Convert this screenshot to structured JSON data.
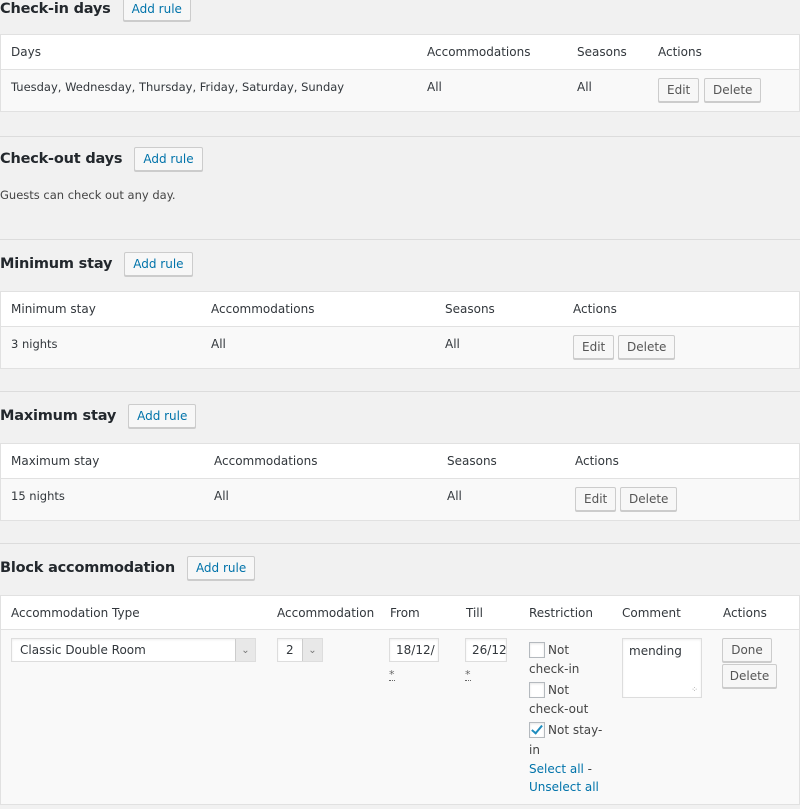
{
  "checkin": {
    "title": "Check-in days",
    "add_label": "Add rule",
    "headers": [
      "Days",
      "Accommodations",
      "Seasons",
      "Actions"
    ],
    "rows": [
      {
        "days": "Tuesday, Wednesday, Thursday, Friday, Saturday, Sunday",
        "accommodations": "All",
        "seasons": "All",
        "edit": "Edit",
        "delete": "Delete"
      }
    ]
  },
  "checkout": {
    "title": "Check-out days",
    "add_label": "Add rule",
    "note": "Guests can check out any day."
  },
  "minstay": {
    "title": "Minimum stay",
    "add_label": "Add rule",
    "headers": [
      "Minimum stay",
      "Accommodations",
      "Seasons",
      "Actions"
    ],
    "rows": [
      {
        "value": "3 nights",
        "accommodations": "All",
        "seasons": "All",
        "edit": "Edit",
        "delete": "Delete"
      }
    ]
  },
  "maxstay": {
    "title": "Maximum stay",
    "add_label": "Add rule",
    "headers": [
      "Maximum stay",
      "Accommodations",
      "Seasons",
      "Actions"
    ],
    "rows": [
      {
        "value": "15 nights",
        "accommodations": "All",
        "seasons": "All",
        "edit": "Edit",
        "delete": "Delete"
      }
    ]
  },
  "block": {
    "title": "Block accommodation",
    "add_label": "Add rule",
    "headers": [
      "Accommodation Type",
      "Accommodation",
      "From",
      "Till",
      "Restriction",
      "Comment",
      "Actions"
    ],
    "row": {
      "type_value": "Classic Double Room",
      "accommodation_value": "2",
      "from_value": "18/12/",
      "till_value": "26/12",
      "required_mark": "*",
      "restrictions": [
        {
          "line1": "Not",
          "line2": "check-in",
          "checked": false
        },
        {
          "line1": "Not",
          "line2": "check-out",
          "checked": false
        },
        {
          "line1": "Not stay-",
          "line2": "in",
          "checked": true
        }
      ],
      "select_all": "Select all",
      "separator": " -",
      "unselect_all": "Unselect all",
      "comment": "mending",
      "done": "Done",
      "delete": "Delete"
    }
  },
  "colors": {
    "link": "#0073aa",
    "background": "#f1f1f1",
    "check": "#1e8cbe"
  }
}
